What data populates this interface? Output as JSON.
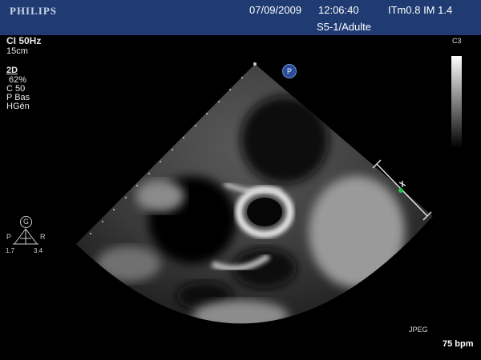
{
  "header": {
    "brand": "PHILIPS",
    "date": "07/09/2009",
    "time": "12:06:40",
    "itm_im": "ITm0.8  IM 1.4",
    "probe_preset": "S5-1/Adulte"
  },
  "left_params": {
    "mode_line": "CI 50Hz",
    "depth": "15cm",
    "mode": "2D",
    "gain": "62%",
    "compression": "C 50",
    "power": "P Bas",
    "harmonic": "HGén"
  },
  "orientation": {
    "marker": "G",
    "left_label": "P",
    "right_label": "R",
    "left_value": "1.7",
    "right_value": "3.4"
  },
  "scan_marker_label": "P",
  "grayscale_label": "C3",
  "format_label": "JPEG",
  "heart_rate": "75 bpm",
  "colors": {
    "header_bg": "#1f3b72",
    "background": "#000000",
    "text": "#e8e8e8",
    "accent_green": "#22c24a"
  }
}
